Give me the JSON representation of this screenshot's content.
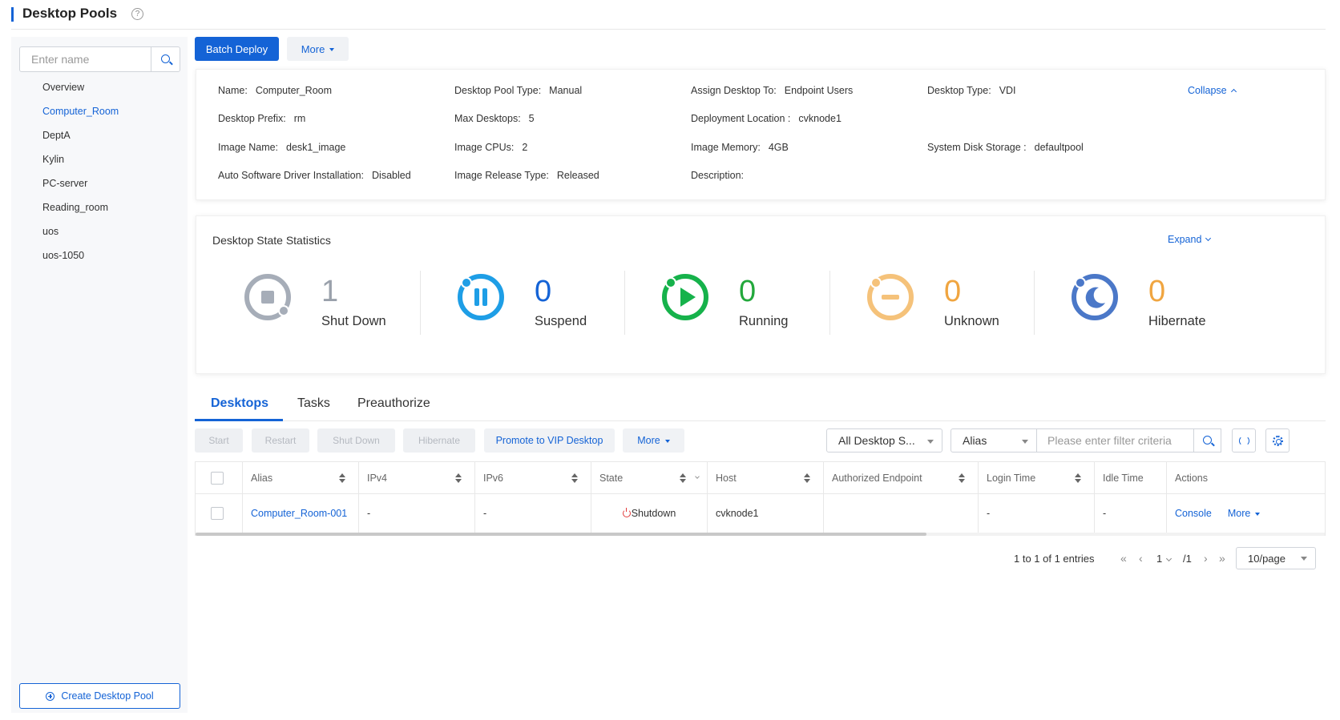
{
  "header": {
    "title": "Desktop Pools",
    "help_icon": "question-circle-icon"
  },
  "sidebar": {
    "search_placeholder": "Enter name",
    "items": [
      {
        "label": "Overview",
        "active": false
      },
      {
        "label": "Computer_Room",
        "active": true
      },
      {
        "label": "DeptA",
        "active": false
      },
      {
        "label": "Kylin",
        "active": false
      },
      {
        "label": "PC-server",
        "active": false
      },
      {
        "label": "Reading_room",
        "active": false
      },
      {
        "label": "uos",
        "active": false
      },
      {
        "label": "uos-1050",
        "active": false
      }
    ],
    "create_label": "Create Desktop Pool"
  },
  "toolbar": {
    "batch_deploy": "Batch Deploy",
    "more": "More"
  },
  "info": {
    "collapse": "Collapse",
    "fields": [
      {
        "label": "Name:",
        "value": "Computer_Room"
      },
      {
        "label": "Desktop Pool Type:",
        "value": "Manual"
      },
      {
        "label": "Assign Desktop To:",
        "value": "Endpoint Users"
      },
      {
        "label": "Desktop Type:",
        "value": "VDI"
      },
      {
        "label": "Desktop Prefix:",
        "value": "rm"
      },
      {
        "label": "Max Desktops:",
        "value": "5"
      },
      {
        "label": "Deployment Location :",
        "value": "cvknode1"
      },
      {
        "label": "Image Name:",
        "value": "desk1_image"
      },
      {
        "label": "Image CPUs:",
        "value": "2"
      },
      {
        "label": "Image Memory:",
        "value": "4GB"
      },
      {
        "label": "System Disk Storage :",
        "value": "defaultpool"
      },
      {
        "label": "Auto Software Driver Installation:",
        "value": "Disabled"
      },
      {
        "label": "Image Release Type:",
        "value": "Released"
      },
      {
        "label": "Description:",
        "value": ""
      }
    ]
  },
  "stats": {
    "title": "Desktop State Statistics",
    "expand": "Expand",
    "items": [
      {
        "label": "Shut Down",
        "count": "1",
        "color": "#a6adb8",
        "num_color": "#9aa1ab",
        "icon": "stop-icon"
      },
      {
        "label": "Suspend",
        "count": "0",
        "color": "#1e9ee6",
        "num_color": "#1463d6",
        "icon": "pause-icon"
      },
      {
        "label": "Running",
        "count": "0",
        "color": "#16b24b",
        "num_color": "#23a83c",
        "icon": "play-icon"
      },
      {
        "label": "Unknown",
        "count": "0",
        "color": "#f5c27a",
        "num_color": "#f0a540",
        "icon": "minus-icon"
      },
      {
        "label": "Hibernate",
        "count": "0",
        "color": "#4b78c8",
        "num_color": "#f0a540",
        "icon": "moon-icon"
      }
    ]
  },
  "tabs": [
    {
      "label": "Desktops",
      "active": true
    },
    {
      "label": "Tasks",
      "active": false
    },
    {
      "label": "Preauthorize",
      "active": false
    }
  ],
  "actions": {
    "start": "Start",
    "restart": "Restart",
    "shutdown": "Shut Down",
    "hibernate": "Hibernate",
    "promote": "Promote to VIP Desktop",
    "more": "More",
    "state_filter": "All Desktop S...",
    "field_filter": "Alias",
    "filter_placeholder": "Please enter filter criteria"
  },
  "table": {
    "columns": [
      "Alias",
      "IPv4",
      "IPv6",
      "State",
      "Host",
      "Authorized Endpoint",
      "Login Time",
      "Idle Time",
      "Actions"
    ],
    "rows": [
      {
        "alias": "Computer_Room-001",
        "ipv4": "-",
        "ipv6": "-",
        "state": "Shutdown",
        "host": "cvknode1",
        "endpoint": "",
        "login_time": "-",
        "idle_time": "-",
        "console": "Console",
        "more": "More"
      }
    ]
  },
  "pagination": {
    "summary": "1 to 1 of 1 entries",
    "current": "1",
    "total": "/1",
    "page_size": "10/page"
  }
}
